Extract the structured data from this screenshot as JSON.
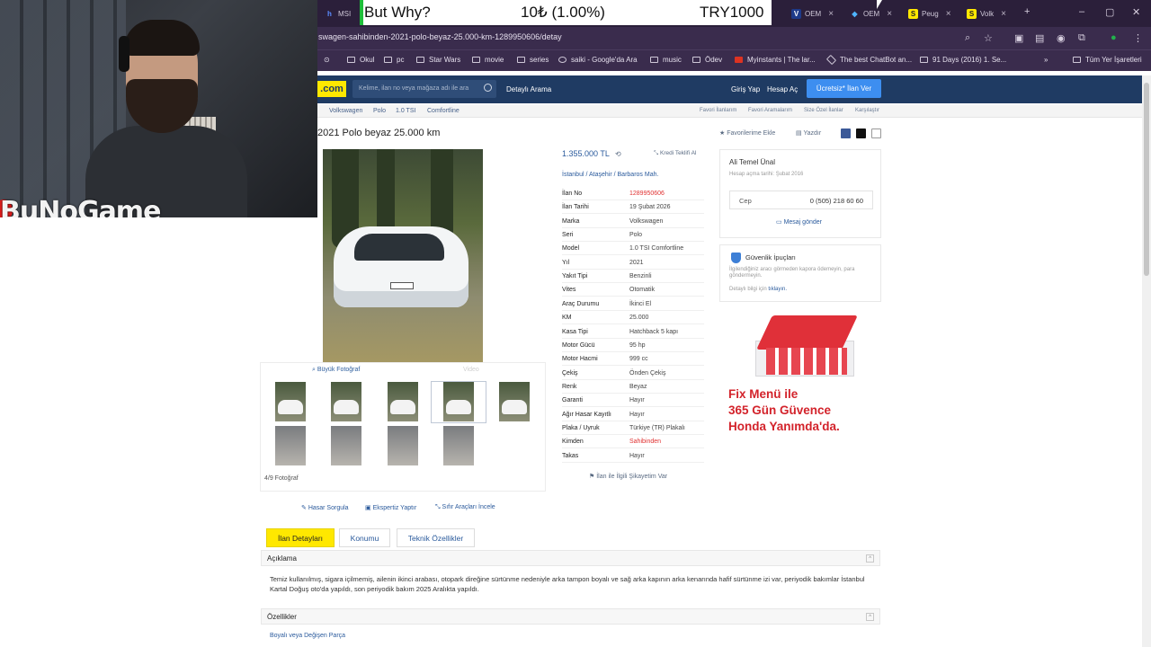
{
  "overlay": {
    "ticker_title": "But Why?",
    "ticker_amount": "10₺ (1.00%)",
    "ticker_goal": "TRY1000",
    "brand": "BuNoGame"
  },
  "tabs": [
    {
      "label": "MSI",
      "icon": "msi-icon"
    },
    {
      "label": "OEM",
      "icon": "v-icon"
    },
    {
      "label": "OEM",
      "icon": "diamond-icon"
    },
    {
      "label": "Peug",
      "icon": "s-icon"
    },
    {
      "label": "Volk",
      "icon": "s-icon"
    }
  ],
  "url": "swagen-sahibinden-2021-polo-beyaz-25.000-km-1289950606/detay",
  "bookmarks": [
    "Okul",
    "pc",
    "Star Wars",
    "movie",
    "series",
    "saiki - Google'da Ara",
    "music",
    "Ödev",
    "Myinstants | The lar...",
    "The best ChatBot an...",
    "91 Days (2016) 1. Se..."
  ],
  "all_bookmarks": "Tüm Yer İşaretleri",
  "header": {
    "logo": ".com",
    "search_placeholder": "Kelime, ilan no veya mağaza adı ile ara",
    "detailed_search": "Detaylı Arama",
    "login": "Giriş Yap",
    "register": "Hesap Aç",
    "post_ad": "Ücretsiz* İlan Ver"
  },
  "breadcrumbs": [
    "Volkswagen",
    "Polo",
    "1.0 TSI",
    "Comfortline"
  ],
  "breadcrumb_right": [
    "Favori İlanlarım",
    "Favori Aramalarım",
    "Size Özel İlanlar",
    "Karşılaştır"
  ],
  "listing": {
    "title": "2021 Polo beyaz 25.000 km",
    "add_favorite": "Favorilerime Ekle",
    "print": "Yazdır",
    "price": "1.355.000 TL",
    "credit": "Kredi Teklifi Al",
    "location": [
      "İstanbul",
      "Ataşehir",
      "Barbaros Mah."
    ],
    "big_photo": "Büyük Fotoğraf",
    "video": "Video",
    "photo_count": "4/9 Fotoğraf",
    "complain": "İlan ile İlgili Şikayetim Var"
  },
  "specs": [
    {
      "k": "İlan No",
      "v": "1289950606",
      "red": true
    },
    {
      "k": "İlan Tarihi",
      "v": "19 Şubat 2026"
    },
    {
      "k": "Marka",
      "v": "Volkswagen"
    },
    {
      "k": "Seri",
      "v": "Polo"
    },
    {
      "k": "Model",
      "v": "1.0 TSI Comfortline"
    },
    {
      "k": "Yıl",
      "v": "2021"
    },
    {
      "k": "Yakıt Tipi",
      "v": "Benzinli"
    },
    {
      "k": "Vites",
      "v": "Otomatik"
    },
    {
      "k": "Araç Durumu",
      "v": "İkinci El"
    },
    {
      "k": "KM",
      "v": "25.000"
    },
    {
      "k": "Kasa Tipi",
      "v": "Hatchback 5 kapı"
    },
    {
      "k": "Motor Gücü",
      "v": "95 hp"
    },
    {
      "k": "Motor Hacmi",
      "v": "999 cc"
    },
    {
      "k": "Çekiş",
      "v": "Önden Çekiş"
    },
    {
      "k": "Renk",
      "v": "Beyaz"
    },
    {
      "k": "Garanti",
      "v": "Hayır"
    },
    {
      "k": "Ağır Hasar Kayıtlı",
      "v": "Hayır"
    },
    {
      "k": "Plaka / Uyruk",
      "v": "Türkiye (TR) Plakalı"
    },
    {
      "k": "Kimden",
      "v": "Sahibinden",
      "red": true
    },
    {
      "k": "Takas",
      "v": "Hayır"
    }
  ],
  "seller": {
    "name": "Ali Temel Ünal",
    "since": "Hesap açma tarihi: Şubat 2016",
    "phone_label": "Cep",
    "phone": "0 (505) 218 60 60",
    "message": "Mesaj gönder"
  },
  "safety": {
    "title": "Güvenlik İpuçları",
    "text": "İlgilendiğiniz aracı görmeden kapora ödemeyin, para göndermeyin.",
    "link_prefix": "Detaylı bilgi için",
    "link": "tıklayın."
  },
  "ad": {
    "line1": "Fix Menü ile",
    "line2": "365 Gün Güvence",
    "line3": "Honda Yanımda'da."
  },
  "tools": [
    "Hasar Sorgula",
    "Ekspertiz Yaptır",
    "Sıfır Araçları İncele"
  ],
  "detail_tabs": [
    "İlan Detayları",
    "Konumu",
    "Teknik Özellikler"
  ],
  "sections": {
    "description_title": "Açıklama",
    "description": "Temiz kullanılmış, sigara içilmemiş, ailenin ikinci arabası, otopark direğine sürtünme nedeniyle arka tampon boyalı ve sağ arka kapının arka kenarında hafif sürtünme izi var, periyodik bakımlar İstanbul Kartal Doğuş oto'da yapıldı, son periyodik bakım 2025 Aralıkta yapıldı.",
    "features_title": "Özellikler",
    "features_link": "Boyalı veya Değişen Parça"
  }
}
